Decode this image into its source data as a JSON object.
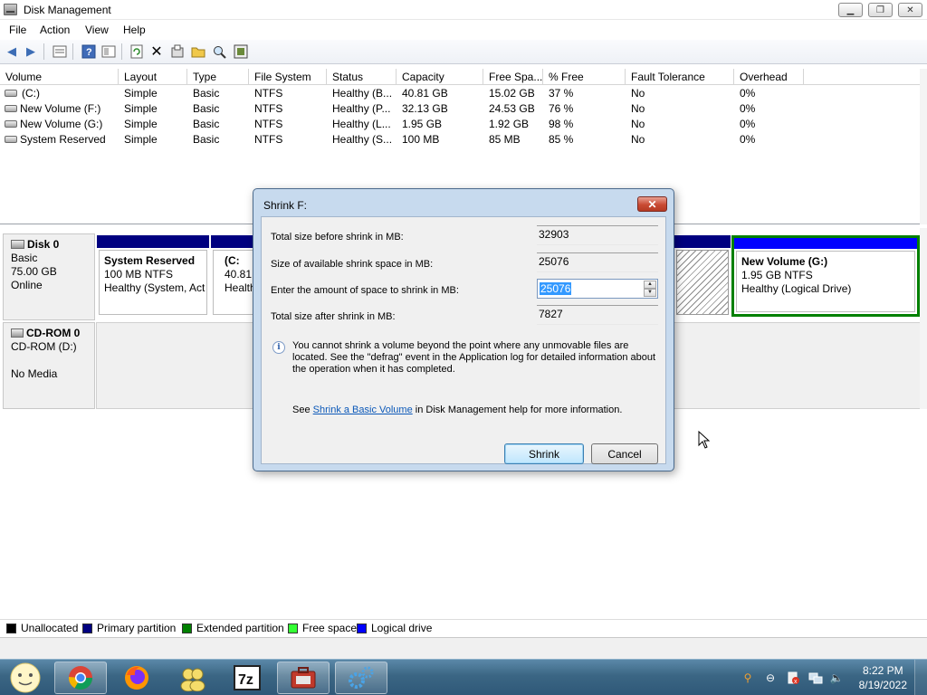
{
  "window": {
    "title": "Disk Management"
  },
  "menu": [
    "File",
    "Action",
    "View",
    "Help"
  ],
  "toolbar": {
    "icons": [
      "back-icon",
      "forward-icon",
      "properties-icon",
      "help-icon",
      "view-icon",
      "refresh-icon",
      "delete-icon",
      "settings-icon",
      "open-icon",
      "search-icon",
      "console-icon"
    ]
  },
  "volumes": {
    "columns": [
      "Volume",
      "Layout",
      "Type",
      "File System",
      "Status",
      "Capacity",
      "Free Spa...",
      "% Free",
      "Fault Tolerance",
      "Overhead"
    ],
    "rows": [
      [
        "(C:)",
        "Simple",
        "Basic",
        "NTFS",
        "Healthy (B...",
        "40.81 GB",
        "15.02 GB",
        "37 %",
        "No",
        "0%"
      ],
      [
        "New Volume (F:)",
        "Simple",
        "Basic",
        "NTFS",
        "Healthy (P...",
        "32.13 GB",
        "24.53 GB",
        "76 %",
        "No",
        "0%"
      ],
      [
        "New Volume (G:)",
        "Simple",
        "Basic",
        "NTFS",
        "Healthy (L...",
        "1.95 GB",
        "1.92 GB",
        "98 %",
        "No",
        "0%"
      ],
      [
        "System Reserved",
        "Simple",
        "Basic",
        "NTFS",
        "Healthy (S...",
        "100 MB",
        "85 MB",
        "85 %",
        "No",
        "0%"
      ]
    ]
  },
  "disk0": {
    "name": "Disk 0",
    "type": "Basic",
    "size": "75.00 GB",
    "state": "Online",
    "partitions": {
      "reserved": {
        "name": "System Reserved",
        "size": "100 MB NTFS",
        "status": "Healthy (System, Act"
      },
      "c": {
        "name": "(C:",
        "size": "40.81 G",
        "status": "Healthy"
      },
      "g": {
        "name": "New Volume  (G:)",
        "size": "1.95 GB NTFS",
        "status": "Healthy (Logical Drive)"
      }
    }
  },
  "cdrom0": {
    "name": "CD-ROM 0",
    "drive": "CD-ROM (D:)",
    "media": "No Media"
  },
  "legend": [
    {
      "label": "Unallocated",
      "color": "#000000"
    },
    {
      "label": "Primary partition",
      "color": "#000080"
    },
    {
      "label": "Extended partition",
      "color": "#008000"
    },
    {
      "label": "Free space",
      "color": "#33ff33"
    },
    {
      "label": "Logical drive",
      "color": "#0000ff"
    }
  ],
  "dialog": {
    "title": "Shrink F:",
    "total_before_label": "Total size before shrink in MB:",
    "total_before_value": "32903",
    "available_label": "Size of available shrink space in MB:",
    "available_value": "25076",
    "amount_label": "Enter the amount of space to shrink in MB:",
    "amount_value": "25076",
    "total_after_label": "Total size after shrink in MB:",
    "total_after_value": "7827",
    "info_text": "You cannot shrink a volume beyond the point where any unmovable files are located. See the \"defrag\" event in the Application log for detailed information about the operation when it has completed.",
    "help_prefix": "See ",
    "help_link": "Shrink a Basic Volume",
    "help_suffix": " in Disk Management help for more information.",
    "shrink_button": "Shrink",
    "cancel_button": "Cancel"
  },
  "taskbar": {
    "apps": [
      "start-orb-icon",
      "chrome-icon",
      "firefox-icon",
      "users-icon",
      "7zip-icon",
      "computer-management-icon",
      "settings-gears-icon"
    ],
    "clock_time": "8:22 PM",
    "clock_date": "8/19/2022"
  }
}
